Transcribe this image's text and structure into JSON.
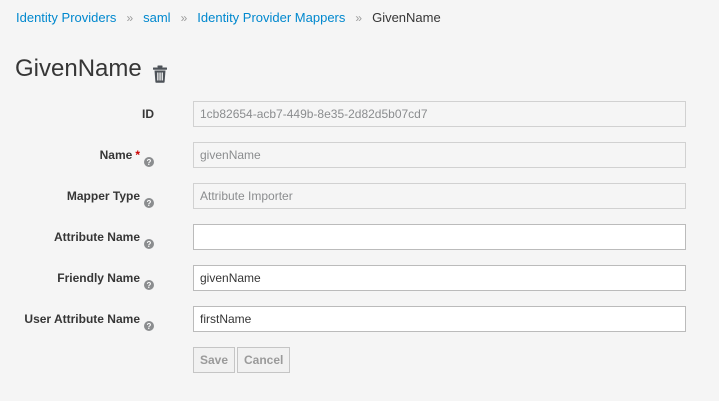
{
  "breadcrumb": {
    "items": [
      "Identity Providers",
      "saml",
      "Identity Provider Mappers"
    ],
    "current": "GivenName",
    "separator": "»"
  },
  "page": {
    "title": "GivenName",
    "delete_icon": "trash-icon"
  },
  "form": {
    "id": {
      "label": "ID",
      "value": "1cb82654-acb7-449b-8e35-2d82d5b07cd7"
    },
    "name": {
      "label": "Name",
      "required_mark": "*",
      "value": "givenName"
    },
    "mapper_type": {
      "label": "Mapper Type",
      "value": "Attribute Importer"
    },
    "attribute_name": {
      "label": "Attribute Name",
      "value": ""
    },
    "friendly_name": {
      "label": "Friendly Name",
      "value": "givenName"
    },
    "user_attribute_name": {
      "label": "User Attribute Name",
      "value": "firstName"
    }
  },
  "actions": {
    "save_label": "Save",
    "cancel_label": "Cancel"
  },
  "colors": {
    "link": "#0088ce",
    "required": "#cc0000",
    "background": "#f5f5f5"
  }
}
